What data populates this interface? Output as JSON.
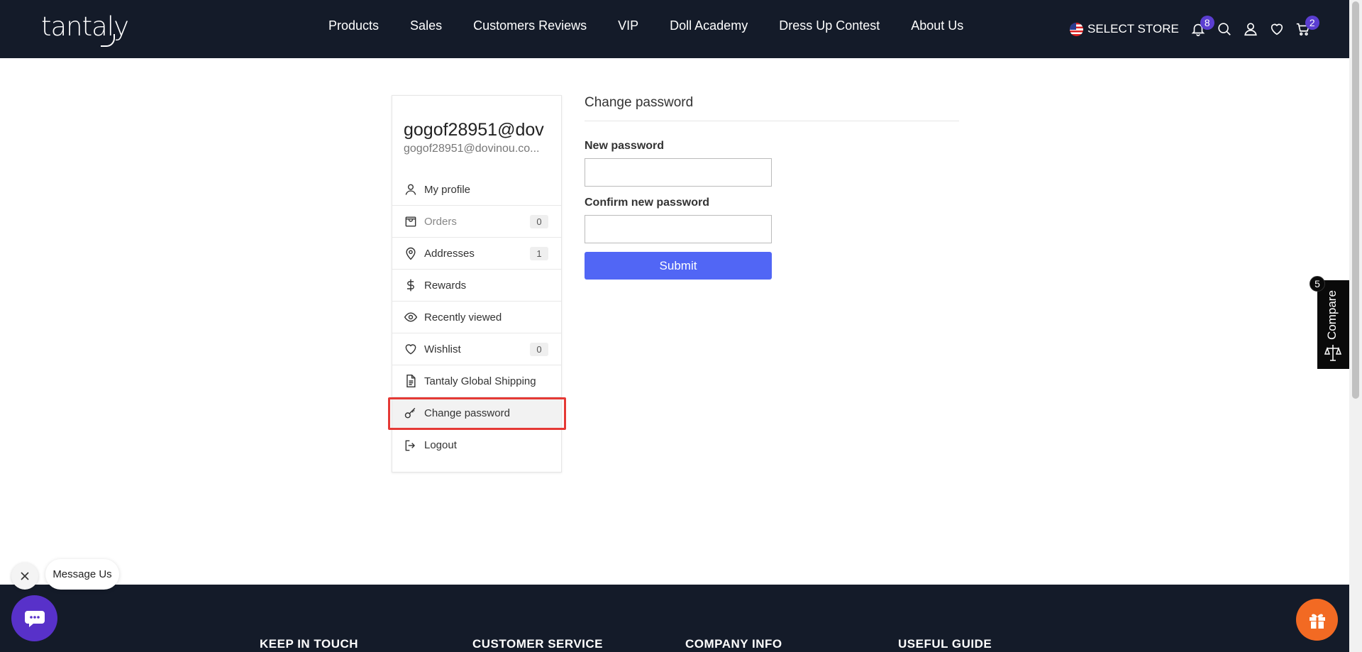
{
  "header": {
    "logo": "tantaly",
    "nav": [
      "Products",
      "Sales",
      "Customers Reviews",
      "VIP",
      "Doll Academy",
      "Dress Up Contest",
      "About Us"
    ],
    "select_store": "SELECT STORE",
    "notifications_count": "8",
    "cart_count": "2"
  },
  "account": {
    "name": "gogof28951@dov",
    "email": "gogof28951@dovinou.co...",
    "menu": [
      {
        "label": "My profile",
        "icon": "user-icon"
      },
      {
        "label": "Orders",
        "count": "0",
        "icon": "bag-icon"
      },
      {
        "label": "Addresses",
        "count": "1",
        "icon": "map-pin-icon"
      },
      {
        "label": "Rewards",
        "icon": "dollar-icon"
      },
      {
        "label": "Recently viewed",
        "icon": "eye-icon"
      },
      {
        "label": "Wishlist",
        "count": "0",
        "icon": "heart-icon"
      },
      {
        "label": "Tantaly Global Shipping",
        "icon": "document-icon"
      },
      {
        "label": "Change password",
        "icon": "key-icon"
      },
      {
        "label": "Logout",
        "icon": "logout-icon"
      }
    ]
  },
  "form": {
    "title": "Change password",
    "new_password_label": "New password",
    "confirm_password_label": "Confirm new password",
    "new_password_value": "",
    "confirm_password_value": "",
    "submit_label": "Submit"
  },
  "compare": {
    "label": "Compare",
    "count": "5"
  },
  "chat": {
    "message_label": "Message Us"
  },
  "footer": {
    "columns": [
      "KEEP IN TOUCH",
      "CUSTOMER SERVICE",
      "COMPANY INFO",
      "USEFUL GUIDE"
    ]
  }
}
